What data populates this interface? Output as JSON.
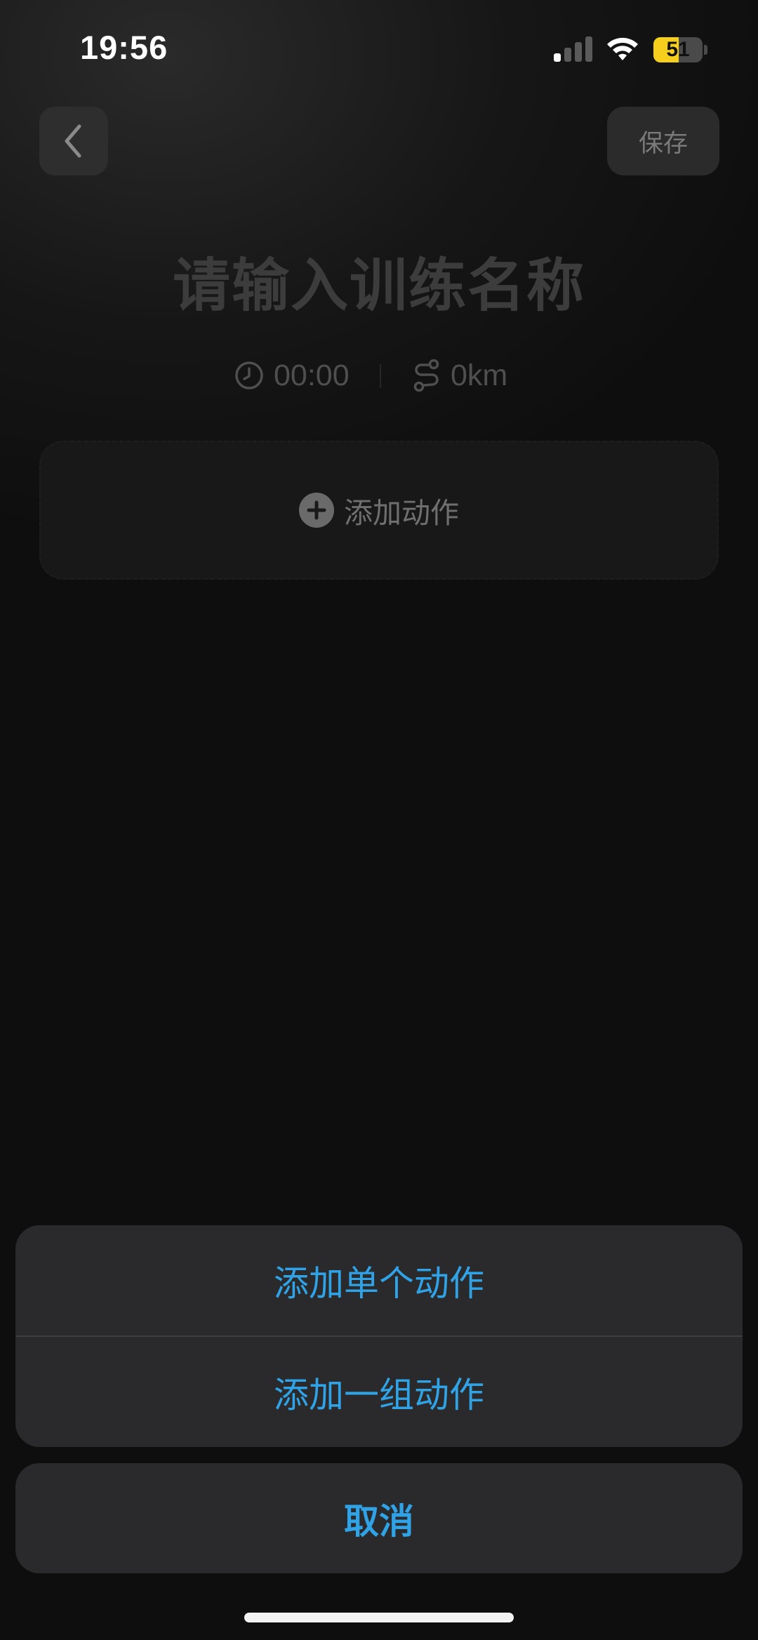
{
  "status_bar": {
    "time": "19:56",
    "battery_level": "51",
    "battery_color": "#f5cf1c",
    "signal_bars_active": 1,
    "icons": [
      "signal-icon",
      "wifi-icon",
      "battery-icon"
    ]
  },
  "header": {
    "back_icon": "chevron-left-icon",
    "save_label": "保存"
  },
  "workout": {
    "title_placeholder": "请输入训练名称",
    "duration": "00:00",
    "distance": "0km",
    "duration_icon": "clock-icon",
    "distance_icon": "route-icon"
  },
  "add_card": {
    "icon": "plus-circle-icon",
    "label": "添加动作"
  },
  "action_sheet": {
    "options": [
      {
        "label": "添加单个动作"
      },
      {
        "label": "添加一组动作"
      }
    ],
    "cancel_label": "取消",
    "accent_color": "#2fa3e6"
  }
}
